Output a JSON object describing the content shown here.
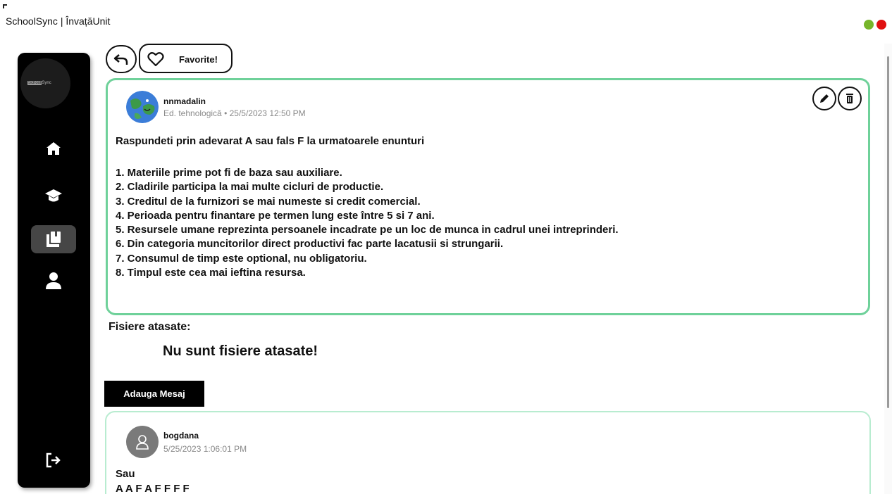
{
  "window": {
    "title": "SchoolSync | ÎnvațăUnit"
  },
  "sidebar": {
    "logo_prefix": "School",
    "logo_suffix": "Sync",
    "items": [
      {
        "name": "home",
        "icon": "home-icon"
      },
      {
        "name": "courses",
        "icon": "graduation-cap-icon"
      },
      {
        "name": "library",
        "icon": "book-icon",
        "active": true
      },
      {
        "name": "profile",
        "icon": "person-icon"
      }
    ],
    "logout_icon": "logout-icon"
  },
  "toolbar": {
    "favorite_label": "Favorite!"
  },
  "post": {
    "author": "nnmadalin",
    "meta": "Ed. tehnologică • 25/5/2023 12:50 PM",
    "title": "Raspundeti prin adevarat A sau fals F la urmatoarele enunturi",
    "lines": [
      "1. Materiile prime pot fi de baza sau auxiliare.",
      "2. Cladirile participa la mai multe cicluri de productie.",
      "3. Creditul de la furnizori se mai numeste si credit comercial.",
      "4. Perioada pentru finantare pe termen lung este între 5 si 7 ani.",
      "5. Resursele umane reprezinta persoanele incadrate pe un loc de munca in cadrul unei intreprinderi.",
      "6. Din categoria muncitorilor direct productivi fac parte lacatusii si strungarii.",
      "7. Consumul de timp este optional, nu obligatoriu.",
      "8. Timpul este cea mai ieftina resursa."
    ]
  },
  "attachments": {
    "label": "Fisiere atasate:",
    "empty_text": "Nu sunt fisiere atasate!"
  },
  "add_message_label": "Adauga Mesaj",
  "comments": [
    {
      "author": "bogdana",
      "time": "5/25/2023 1:06:01 PM",
      "lines": [
        "Sau",
        "A A F A F F F F"
      ]
    }
  ],
  "colors": {
    "accent_green": "#6fd19a",
    "sidebar_bg": "#000000",
    "status_green": "#76b52a",
    "status_red": "#e01010"
  }
}
